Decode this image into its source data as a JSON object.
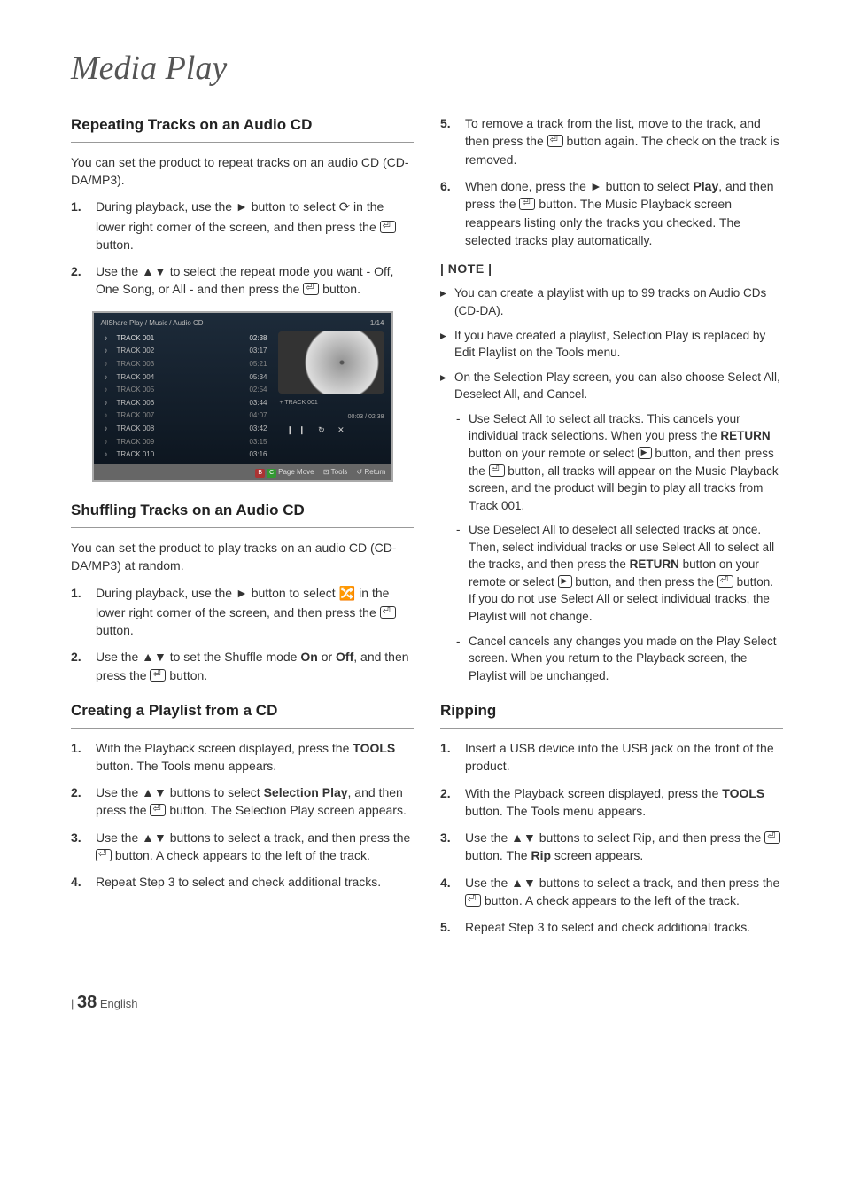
{
  "page_title": "Media Play",
  "left": {
    "repeating": {
      "heading": "Repeating Tracks on an Audio CD",
      "intro": "You can set the product to repeat tracks on an audio CD (CD-DA/MP3).",
      "steps": [
        {
          "n": "1.",
          "pre": "During playback, use the ► button to select ",
          "icon": "repeat",
          "mid": " in the lower right corner of the screen, and then press the ",
          "post": " button."
        },
        {
          "n": "2.",
          "pre": "Use the ▲▼ to select the repeat mode you want - Off, One Song, or All - and then press the ",
          "post": " button."
        }
      ]
    },
    "screenshot": {
      "breadcrumb": "AllShare Play  / Music /      Audio CD",
      "counter": "1/14",
      "tracks": [
        {
          "name": "TRACK 001",
          "time": "02:38"
        },
        {
          "name": "TRACK 002",
          "time": "03:17"
        },
        {
          "name": "TRACK 003",
          "time": "05:21"
        },
        {
          "name": "TRACK 004",
          "time": "05:34"
        },
        {
          "name": "TRACK 005",
          "time": "02:54"
        },
        {
          "name": "TRACK 006",
          "time": "03:44"
        },
        {
          "name": "TRACK 007",
          "time": "04:07"
        },
        {
          "name": "TRACK 008",
          "time": "03:42"
        },
        {
          "name": "TRACK 009",
          "time": "03:15"
        },
        {
          "name": "TRACK 010",
          "time": "03:16"
        }
      ],
      "now_playing": "+ TRACK 001",
      "time": "00:03 / 02:38",
      "controls": "❙❙   ↻   ✕",
      "bar": {
        "pagemove": "Page Move",
        "tools": "Tools",
        "ret": "Return"
      }
    },
    "shuffling": {
      "heading": "Shuffling Tracks on an Audio CD",
      "intro": "You can set the product to play tracks on an audio CD (CD-DA/MP3) at random.",
      "steps": [
        {
          "n": "1.",
          "pre": "During playback, use the ► button to select ",
          "icon": "shuffle",
          "mid": " in the lower right corner of the screen, and then press the ",
          "post": " button."
        },
        {
          "n": "2.",
          "pre": "Use the ▲▼ to set the Shuffle mode ",
          "b1": "On",
          "mid": " or ",
          "b2": "Off",
          "mid2": ", and then press the ",
          "post": " button."
        }
      ]
    },
    "playlist": {
      "heading": "Creating a Playlist from a CD",
      "steps": [
        {
          "n": "1.",
          "text": "With the Playback screen displayed, press the ",
          "b": "TOOLS",
          "text2": " button. The Tools menu appears."
        },
        {
          "n": "2.",
          "text": "Use the ▲▼ buttons to select ",
          "b": "Selection Play",
          "text2": ", and then press the ",
          "text3": " button. The Selection Play screen appears."
        },
        {
          "n": "3.",
          "text": "Use the ▲▼ buttons to select a track, and then press the ",
          "text2": " button. A check appears to the left of the track."
        },
        {
          "n": "4.",
          "text": "Repeat Step 3 to select and check additional tracks."
        }
      ]
    }
  },
  "right": {
    "playlist_cont": [
      {
        "n": "5.",
        "text": "To remove a track from the list, move to the track, and then press the ",
        "text2": " button again. The check on the track is removed."
      },
      {
        "n": "6.",
        "text": "When done, press the ► button to select ",
        "b": "Play",
        "text2": ", and then press the ",
        "text3": " button. The Music Playback screen reappears listing only the tracks you checked. The selected tracks play automatically."
      }
    ],
    "note_head": "| NOTE |",
    "notes": [
      {
        "text": "You can create a playlist with up to 99 tracks on Audio CDs (CD-DA)."
      },
      {
        "text": "If you have created a playlist, Selection Play is replaced by Edit Playlist on the Tools menu."
      },
      {
        "text": "On the Selection Play screen, you can also choose Select All, Deselect All, and Cancel."
      }
    ],
    "subnotes": [
      {
        "pre": "Use Select All to select all tracks. This cancels your individual track selections. When you press the ",
        "b1": "RETURN",
        "mid1": " button on your remote or select ",
        "mid2": " button, and then press the ",
        "mid3": " button, all tracks will appear on the Music Playback screen, and the product will begin to play all tracks from Track 001."
      },
      {
        "pre": "Use Deselect All to deselect all selected tracks at once. Then, select individual tracks or use Select All to select all the tracks, and then press the ",
        "b1": "RETURN",
        "mid1": " button on your remote or select ",
        "mid2": " button, and then press the ",
        "mid3": " button. If you do not use Select All or select individual tracks, the Playlist will not change."
      },
      {
        "pre": "Cancel cancels any changes you made on the Play Select screen. When you return to the Playback screen, the Playlist will be unchanged."
      }
    ],
    "ripping": {
      "heading": "Ripping",
      "steps": [
        {
          "n": "1.",
          "text": "Insert a USB device into the USB jack on the front of the product."
        },
        {
          "n": "2.",
          "text": "With the Playback screen displayed, press the ",
          "b": "TOOLS",
          "text2": " button. The Tools menu appears."
        },
        {
          "n": "3.",
          "text": "Use the ▲▼ buttons to select Rip, and then press the ",
          "text2": " button. The ",
          "b": "Rip",
          "text3": " screen appears."
        },
        {
          "n": "4.",
          "text": "Use the ▲▼ buttons to select a track, and then press the ",
          "text2": " button. A check appears to the left of the track."
        },
        {
          "n": "5.",
          "text": "Repeat Step 3 to select and check additional tracks."
        }
      ]
    }
  },
  "footer": {
    "sep": "| ",
    "page": "38",
    "lang": " English"
  }
}
